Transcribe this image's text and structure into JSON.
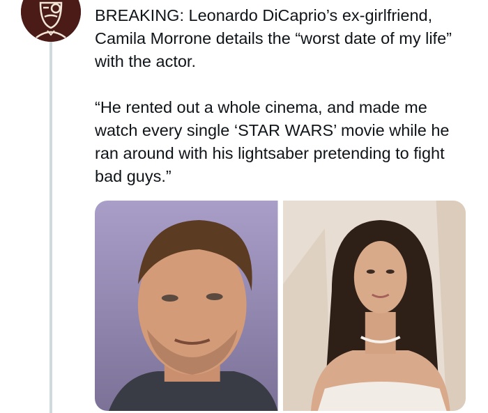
{
  "tweet": {
    "paragraphs": [
      "BREAKING: Leonardo DiCaprio’s ex-girlfriend, Camila Morrone details the “worst date of my life” with the actor.",
      "“He rented out a whole cinema, and made me watch every single ‘STAR WARS’ movie while he ran around with his lightsaber pretending to fight bad guys.”"
    ]
  },
  "avatar": {
    "icon": "masked-figure-icon",
    "color": "#4a1b17"
  },
  "media": {
    "photos": [
      {
        "subject": "man-portrait",
        "background": "#9a8fb8"
      },
      {
        "subject": "woman-portrait",
        "background": "#e7ddd2"
      }
    ]
  }
}
